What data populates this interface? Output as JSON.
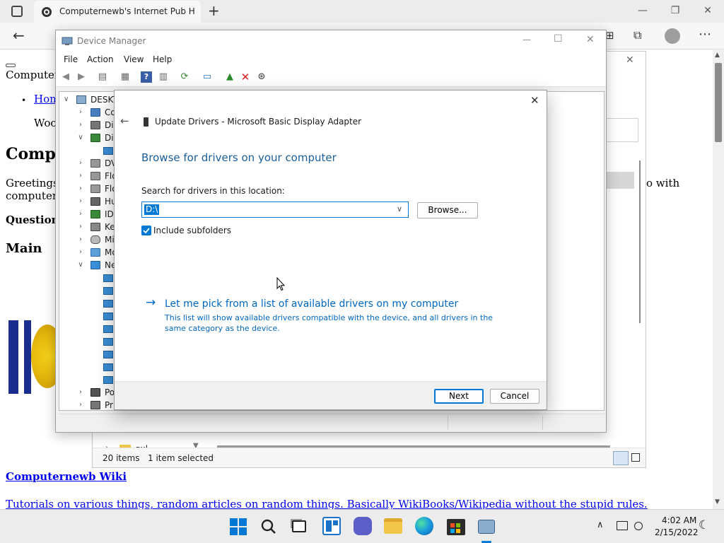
{
  "browser": {
    "tab_title": "Computernewb's Internet Pub H",
    "new_tab_symbol": "+"
  },
  "webpage": {
    "header_text": "Computern",
    "nav_home": "Hom",
    "para_woo": "Woo",
    "heading_main": "Compu",
    "greetings_line1": "Greetings.",
    "greetings_line2": "computers.",
    "greetings_tail": "o with",
    "question_label": "Question/C",
    "main_label": "Main",
    "wiki_link": "Computernewb Wiki",
    "wiki_desc": "Tutorials on various things, random articles on random things. Basically WikiBooks/Wikipedia without the stupid rules."
  },
  "explorer": {
    "folder_item": "gxl",
    "items_count": "20 items",
    "selection": "1 item selected"
  },
  "device_manager": {
    "title": "Device Manager",
    "menu": [
      "File",
      "Action",
      "View",
      "Help"
    ],
    "tree_root": "DESKT",
    "tree_items": [
      "Co",
      "Dis",
      "Dis",
      "DV",
      "Flo",
      "Flo",
      "Hu",
      "IDE",
      "Key",
      "Mi",
      "Mo",
      "Ne",
      "Po",
      "Pri"
    ]
  },
  "dialog": {
    "header": "Update Drivers - Microsoft Basic Display Adapter",
    "heading": "Browse for drivers on your computer",
    "search_label": "Search for drivers in this location:",
    "path_value": "D:\\",
    "browse_label": "Browse...",
    "include_subfolders": "Include subfolders",
    "pick_link": "Let me pick from a list of available drivers on my computer",
    "pick_desc_line1": "This list will show available drivers compatible with the device, and all drivers in the",
    "pick_desc_line2": "same category as the device.",
    "next_label": "Next",
    "cancel_label": "Cancel"
  },
  "taskbar": {
    "time": "4:02 AM",
    "date": "2/15/2022"
  },
  "colors": {
    "accent": "#0078d4",
    "heading_blue": "#1a5e9a",
    "link_blue": "#0067c0",
    "red_x": "#d81e1e"
  }
}
